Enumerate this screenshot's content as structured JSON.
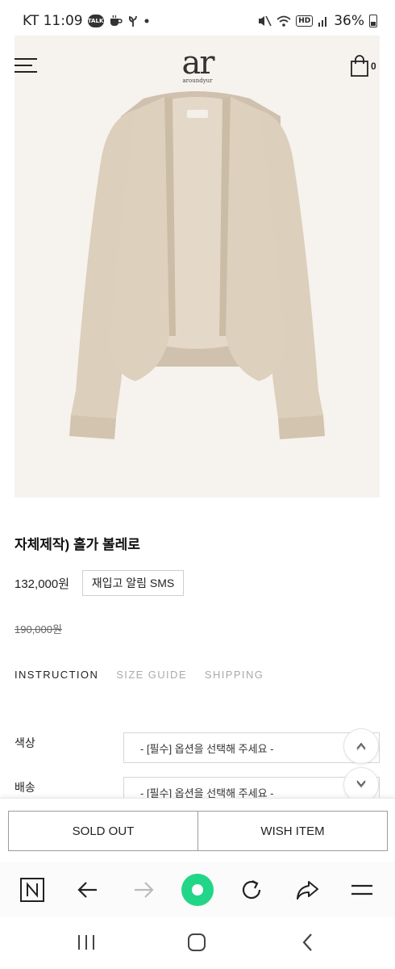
{
  "status_bar": {
    "carrier_time": "KT 11:09",
    "talk_badge": "TALK",
    "hd_badge": "HD",
    "battery": "36%",
    "icons": [
      "talk-icon",
      "coffee-icon",
      "sprout-icon",
      "dot-icon",
      "mute-icon",
      "wifi-icon",
      "hd-icon",
      "signal-icon",
      "battery-icon"
    ]
  },
  "header": {
    "logo_mark": "ar",
    "logo_sub": "aroundyur",
    "cart_count": "0",
    "menu_icon": "hamburger-icon",
    "cart_icon": "shopping-bag-icon"
  },
  "product": {
    "image_alt": "beige knit bolero cardigan",
    "name": "자체제작) 홀가 볼레로",
    "price": "132,000원",
    "restock_label": "재입고 알림 SMS",
    "original_price": "190,000원",
    "colors": {
      "background": "#f6f2ee",
      "sweater": "#ddd0bd"
    }
  },
  "tabs": [
    {
      "label": "INSTRUCTION",
      "active": true
    },
    {
      "label": "SIZE GUIDE",
      "active": false
    },
    {
      "label": "SHIPPING",
      "active": false
    }
  ],
  "options": [
    {
      "label": "색상",
      "placeholder": "- [필수] 옵션을 선택해 주세요 -"
    },
    {
      "label": "배송",
      "placeholder": "- [필수] 옵션을 선택해 주세요 -"
    }
  ],
  "scroll_buttons": {
    "up_icon": "chevron-up-icon",
    "down_icon": "chevron-down-icon"
  },
  "actions": {
    "sold_out": "SOLD OUT",
    "wish_item": "WISH ITEM"
  },
  "browser_toolbar": {
    "icons": [
      "naver-home-icon",
      "back-arrow-icon",
      "forward-arrow-icon",
      "green-dot-icon",
      "refresh-icon",
      "share-icon",
      "menu-icon"
    ],
    "accent": "#22d687"
  },
  "system_nav": {
    "icons": [
      "recent-apps-icon",
      "home-icon",
      "back-icon"
    ]
  }
}
